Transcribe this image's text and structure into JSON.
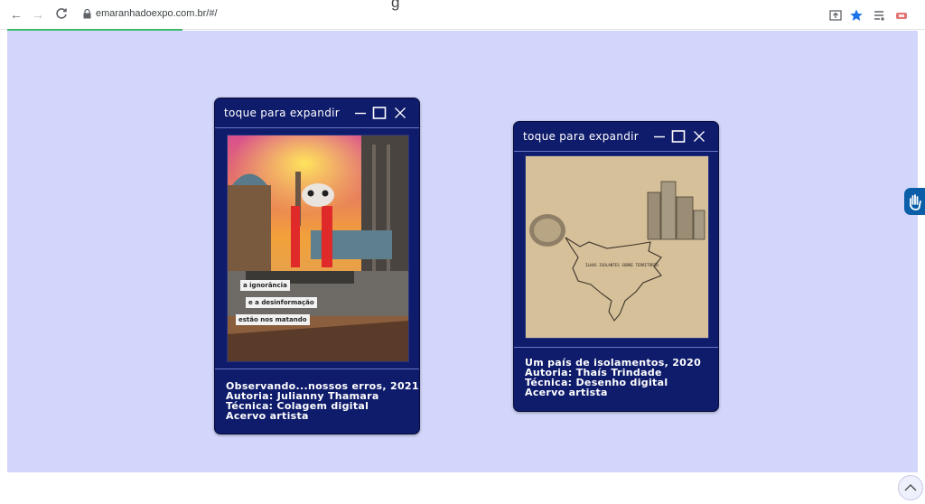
{
  "browser": {
    "url": "emaranhadoexpo.com.br/#/",
    "title_partial": "g",
    "load_progress_percent": 19
  },
  "cards": [
    {
      "header_title": "toque para expandir",
      "artwork_overlay_lines": [
        "a ignorância",
        "e a desinformação",
        "estão nos matando"
      ],
      "info": [
        "Observando...nossos erros, 2021",
        "Autoria: Julianny Thamara",
        "Técnica: Colagem digital",
        "Acervo artista"
      ]
    },
    {
      "header_title": "toque para expandir",
      "artwork_caption": "ILHAS ISOLANTES SOBRE TERRITÓRIO",
      "info": [
        "Um país de isolamentos, 2020",
        "Autoria: Thaís Trindade",
        "Técnica: Desenho digital",
        "Acervo artista"
      ]
    }
  ],
  "colors": {
    "page_background": "#d3d6fb",
    "card_background": "#0f1c6b",
    "progress_bar": "#3fb96b",
    "accessibility_button": "#0b5fa8"
  },
  "icons": [
    "back-arrow-icon",
    "forward-arrow-icon",
    "reload-icon",
    "lock-icon",
    "share-icon",
    "bookmark-star-icon",
    "reading-list-icon",
    "extension-icon",
    "minimize-icon",
    "maximize-icon",
    "close-icon",
    "hand-icon",
    "chevron-up-icon"
  ]
}
